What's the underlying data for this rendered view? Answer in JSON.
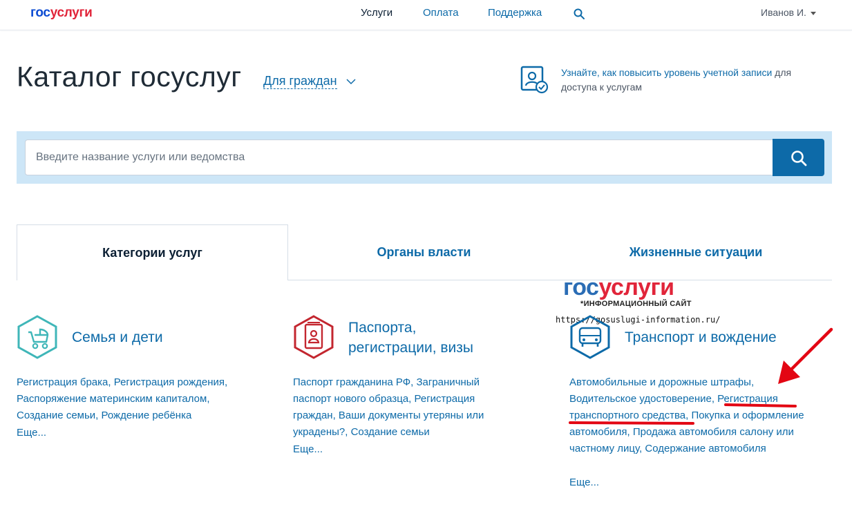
{
  "header": {
    "logo_part1": "гос",
    "logo_part2": "услуги",
    "nav": [
      "Услуги",
      "Оплата",
      "Поддержка"
    ],
    "user": "Иванов И."
  },
  "page": {
    "title": "Каталог госуслуг",
    "audience": "Для граждан",
    "account_link": "Узнайте, как повысить уровень учетной записи",
    "account_rest": " для доступа к услугам"
  },
  "search": {
    "placeholder": "Введите название услуги или ведомства"
  },
  "tabs": [
    "Категории услуг",
    "Органы власти",
    "Жизненные ситуации"
  ],
  "watermark": {
    "logo_part1": "гос",
    "logo_part2": "услуги",
    "subtitle": "*ИНФОРМАЦИОННЫЙ САЙТ",
    "url": "https://gosuslugi-information.ru/"
  },
  "categories": [
    {
      "title": "Семья и дети",
      "links": [
        "Регистрация брака",
        "Регистрация рождения",
        "Распоряжение материнским капиталом",
        "Создание семьи",
        "Рождение ребёнка"
      ],
      "more": "Еще..."
    },
    {
      "title_line1": "Паспорта,",
      "title_line2": "регистрации, визы",
      "links": [
        "Паспорт гражданина РФ",
        "Заграничный паспорт нового образца",
        "Регистрация граждан",
        "Ваши документы утеряны или украдены?",
        "Создание семьи"
      ],
      "more": "Еще..."
    },
    {
      "title": "Транспорт и вождение",
      "links": [
        "Автомобильные и дорожные штрафы",
        "Водительское удостоверение",
        "Регистрация транспортного средства",
        "Покупка и оформление автомобиля",
        "Продажа автомобиля салону или частному лицу",
        "Содержание автомобиля"
      ],
      "more": "Еще..."
    }
  ],
  "colors": {
    "link": "#0d6aa8",
    "brand_blue": "#0d4cd3",
    "brand_red": "#e1253a",
    "search_bg": "#cde6f7",
    "annotation": "#e30613",
    "icon_teal": "#3fb6b8",
    "icon_red": "#c3262f"
  },
  "icons": [
    "search-icon",
    "stroller-icon",
    "passport-icon",
    "car-icon",
    "account-check-icon",
    "chevron-down-icon",
    "caret-down-icon"
  ]
}
